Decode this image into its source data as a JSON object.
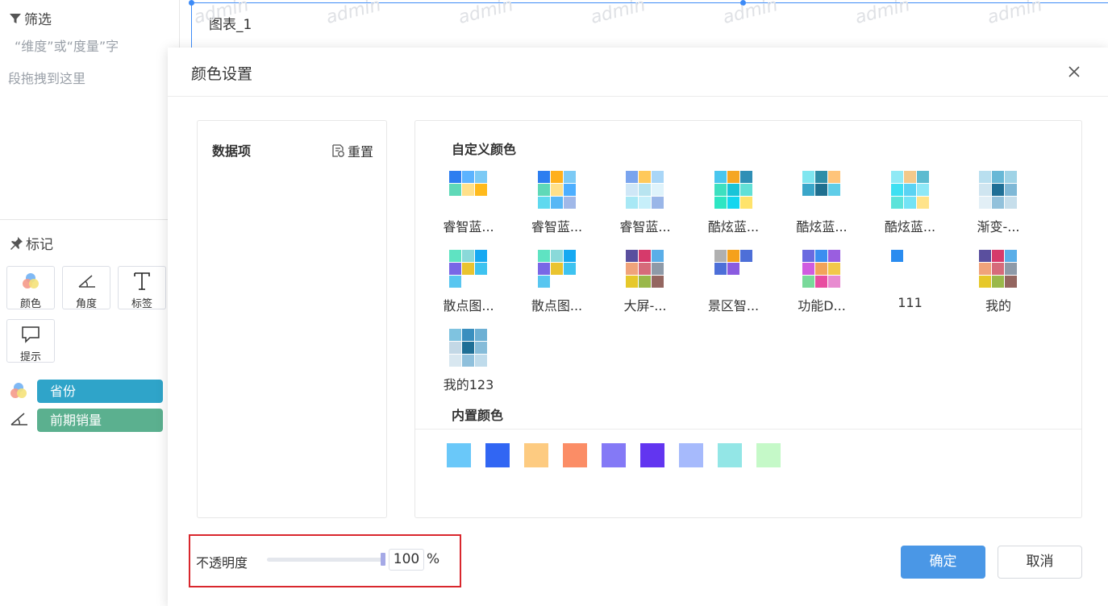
{
  "sidebar": {
    "filter_title": "筛选",
    "filter_hint_line1": "“维度”或“度量”字",
    "filter_hint_line2": "段拖拽到这里",
    "marks_title": "标记",
    "mark_buttons": [
      {
        "label": "颜色",
        "icon": "color-icon"
      },
      {
        "label": "角度",
        "icon": "angle-icon"
      },
      {
        "label": "标签",
        "icon": "text-icon"
      },
      {
        "label": "提示",
        "icon": "comment-icon"
      }
    ],
    "pills": [
      {
        "label": "省份",
        "icon": "color-icon",
        "color": "#2fa4c9"
      },
      {
        "label": "前期销量",
        "icon": "angle-icon",
        "color": "#5bb08f"
      }
    ]
  },
  "canvas": {
    "chart_title": "图表_1",
    "watermark": "admin"
  },
  "dialog": {
    "title": "颜色设置",
    "data_panel": {
      "title": "数据项",
      "reset_label": "重置"
    },
    "custom_title": "自定义颜色",
    "builtin_title": "内置颜色",
    "custom_schemes": [
      {
        "name": "睿智蓝...",
        "colors": [
          "#2d7ef0",
          "#5cb3ff",
          "#7ccaf5",
          "#5fd9b8",
          "#ffe08a",
          "#ffba1c"
        ]
      },
      {
        "name": "睿智蓝...",
        "colors": [
          "#2d7ef0",
          "#ffb01c",
          "#7ccaf5",
          "#5fd9b8",
          "#ffe08a",
          "#4dafff",
          "#5fd9ef",
          "#57b7f5",
          "#a0b8e8"
        ]
      },
      {
        "name": "睿智蓝...",
        "colors": [
          "#7aa4ee",
          "#ffc95a",
          "#a9d6f7",
          "#cfe7f7",
          "#b8e4f0",
          "#dff3fb",
          "#a8e8f5",
          "#c7effa",
          "#9ab6e8"
        ]
      },
      {
        "name": "酷炫蓝...",
        "colors": [
          "#49c6ee",
          "#f5a623",
          "#2f8fb6",
          "#3de0c0",
          "#19c4d8",
          "#62e0d6",
          "#2ee6c3",
          "#14d6ef",
          "#ffe36b"
        ]
      },
      {
        "name": "酷炫蓝...",
        "colors": [
          "#7fe6f0",
          "#2f8ea8",
          "#ffc47a",
          "#3aa6c9",
          "#1f6f8f",
          "#5fcde8"
        ]
      },
      {
        "name": "酷炫蓝...",
        "colors": [
          "#8fe9f5",
          "#f3c98a",
          "#5cbbd0",
          "#3ee0f2",
          "#5ad3f3",
          "#8ee8f7",
          "#5de3da",
          "#73e3f5",
          "#ffe38a"
        ]
      },
      {
        "name": "渐变-...",
        "colors": [
          "#b9dfef",
          "#68b8d6",
          "#9fd3e6",
          "#cfe5f0",
          "#1f6f96",
          "#7fb8d6",
          "#e2eff6",
          "#92c1db",
          "#c6deeb"
        ]
      },
      {
        "name": "散点图...",
        "colors": [
          "#5fe3c2",
          "#8ad9d9",
          "#16a9f2",
          "#7967e6",
          "#eac42f",
          "#3ec3f0",
          "#58c6f0"
        ]
      },
      {
        "name": "散点图...",
        "colors": [
          "#5fe3c2",
          "#8ad9d9",
          "#16a9f2",
          "#7967e6",
          "#eac42f",
          "#3ec3f0",
          "#58c6f0"
        ]
      },
      {
        "name": "大屏-...",
        "colors": [
          "#5a4f9e",
          "#d63a6b",
          "#5aaee8",
          "#f0a37a",
          "#d66b7a",
          "#8e9aa8",
          "#e6c82a",
          "#9ab84a",
          "#946660"
        ]
      },
      {
        "name": "景区智...",
        "colors": [
          "#b0b0b0",
          "#f5a11c",
          "#4d6fd8",
          "#4d6fd8",
          "#8a5be0"
        ]
      },
      {
        "name": "功能D...",
        "colors": [
          "#6a6ae0",
          "#3c8ef0",
          "#9a5ee0",
          "#d05be0",
          "#f2a35a",
          "#f2c84a",
          "#79d99a",
          "#e84ca0",
          "#e88bd0"
        ]
      },
      {
        "name": "111",
        "colors": [
          "#2a8cf0"
        ]
      },
      {
        "name": "我的",
        "colors": [
          "#5a4f9e",
          "#d63a6b",
          "#5aaee8",
          "#f0a37a",
          "#d66b7a",
          "#8e9aa8",
          "#e6c82a",
          "#9ab84a",
          "#946660"
        ]
      },
      {
        "name": "我的123",
        "colors": [
          "#7fc3e0",
          "#3a8fbf",
          "#6db0d4",
          "#c3d8e6",
          "#1f6f96",
          "#86bcd9",
          "#d8e7f0",
          "#8fc0dc",
          "#bfdbeb"
        ]
      }
    ],
    "builtin_colors": [
      "#6ac8f9",
      "#3166f3",
      "#fdcb81",
      "#fb8d66",
      "#8479f6",
      "#6235f0",
      "#a6bafc",
      "#93e6e6",
      "#c5f9c8"
    ],
    "opacity": {
      "label": "不透明度",
      "value": "100",
      "unit": "%",
      "level": 1.0
    },
    "buttons": {
      "ok": "确定",
      "cancel": "取消"
    }
  }
}
